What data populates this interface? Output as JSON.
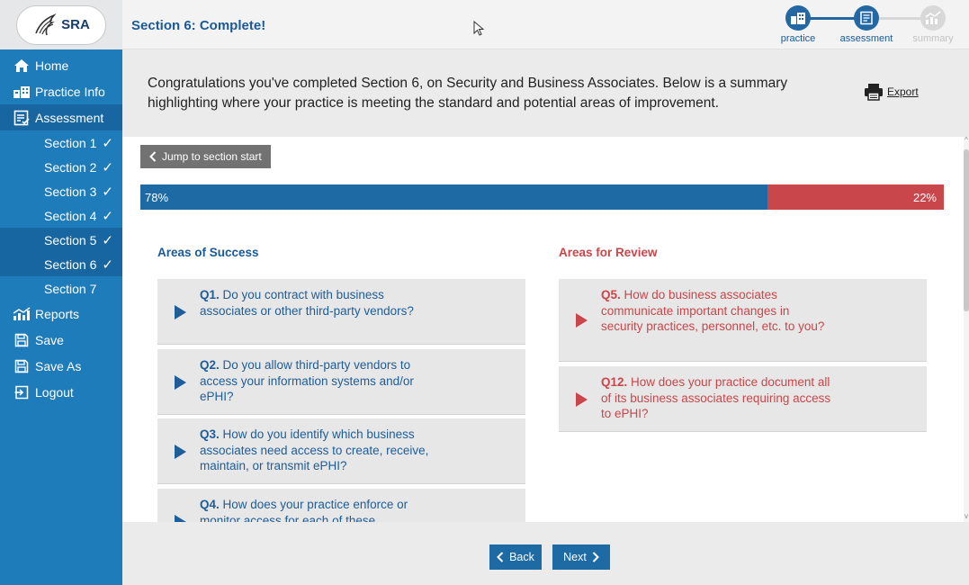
{
  "logo": {
    "text": "SRA"
  },
  "header": {
    "title": "Section 6:  Complete!"
  },
  "steps": [
    {
      "label": "practice",
      "state": "on",
      "icon": "practice-icon"
    },
    {
      "label": "assessment",
      "state": "on",
      "icon": "assessment-icon"
    },
    {
      "label": "summary",
      "state": "off",
      "icon": "summary-icon"
    }
  ],
  "sidebar": {
    "home": "Home",
    "practice_info": "Practice Info",
    "assessment": "Assessment",
    "sections": [
      {
        "label": "Section 1",
        "check": "✓"
      },
      {
        "label": "Section 2",
        "check": "✓"
      },
      {
        "label": "Section 3",
        "check": "✓"
      },
      {
        "label": "Section 4",
        "check": "✓"
      },
      {
        "label": "Section 5",
        "check": "✓"
      },
      {
        "label": "Section 6",
        "check": "✓"
      },
      {
        "label": "Section 7",
        "check": ""
      }
    ],
    "reports": "Reports",
    "save": "Save",
    "save_as": "Save As",
    "logout": "Logout"
  },
  "intro": {
    "text": "Congratulations you've completed Section 6, on Security and Business Associates. Below is a summary highlighting where your practice is meeting the standard and potential areas of improvement.",
    "export_label": "Export"
  },
  "main": {
    "jump_label": "Jump to section start",
    "progress": {
      "success_pct": 78,
      "left_label": "78%",
      "right_label": "22%"
    },
    "success_title": "Areas of Success",
    "review_title": "Areas for Review",
    "success_items": [
      {
        "num": "Q1.",
        "text": " Do you contract with business associates or other third-party vendors?"
      },
      {
        "num": "Q2.",
        "text": " Do you allow third-party vendors to access your information systems and/or ePHI?"
      },
      {
        "num": "Q3.",
        "text": " How do you identify which business associates need access to create, receive, maintain, or transmit ePHI?"
      },
      {
        "num": "Q4.",
        "text": " How does your practice enforce or monitor access for each of these"
      }
    ],
    "review_items": [
      {
        "num": "Q5.",
        "text": " How do business associates communicate important changes in security practices, personnel, etc. to you?"
      },
      {
        "num": "Q12.",
        "text": " How does your practice document all of its business associates requiring access to ePHI?"
      }
    ]
  },
  "footer": {
    "back_label": "Back",
    "next_label": "Next"
  },
  "colors": {
    "sidebar": "#1f7cbb",
    "primary": "#1d6aa5",
    "review": "#c9464a",
    "title": "#1a5a99"
  }
}
